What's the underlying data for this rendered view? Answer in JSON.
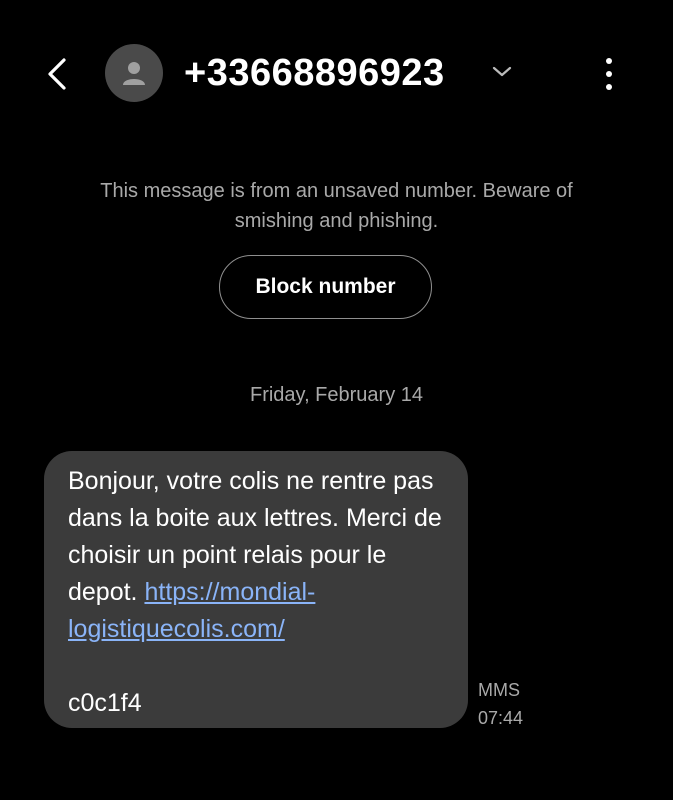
{
  "header": {
    "contact_number": "+33668896923",
    "back_icon": "chevron-left-icon",
    "avatar_icon": "person-icon",
    "expand_icon": "chevron-down-icon",
    "more_icon": "more-vertical-icon"
  },
  "warning": {
    "text": "This message is from an unsaved number. Beware of smishing and phishing.",
    "block_button_label": "Block number"
  },
  "conversation": {
    "date": "Friday, February 14",
    "messages": [
      {
        "text": "Bonjour, votre colis ne rentre pas dans la boite aux lettres. Merci de choisir un point relais pour le depot.",
        "link": "https://mondial-logistiquecolis.com/",
        "code": "c0c1f4",
        "type_label": "MMS",
        "time": "07:44"
      }
    ]
  },
  "colors": {
    "background": "#000000",
    "bubble": "#3b3b3b",
    "link": "#8ab4f8",
    "muted_text": "#a9a9a9"
  }
}
